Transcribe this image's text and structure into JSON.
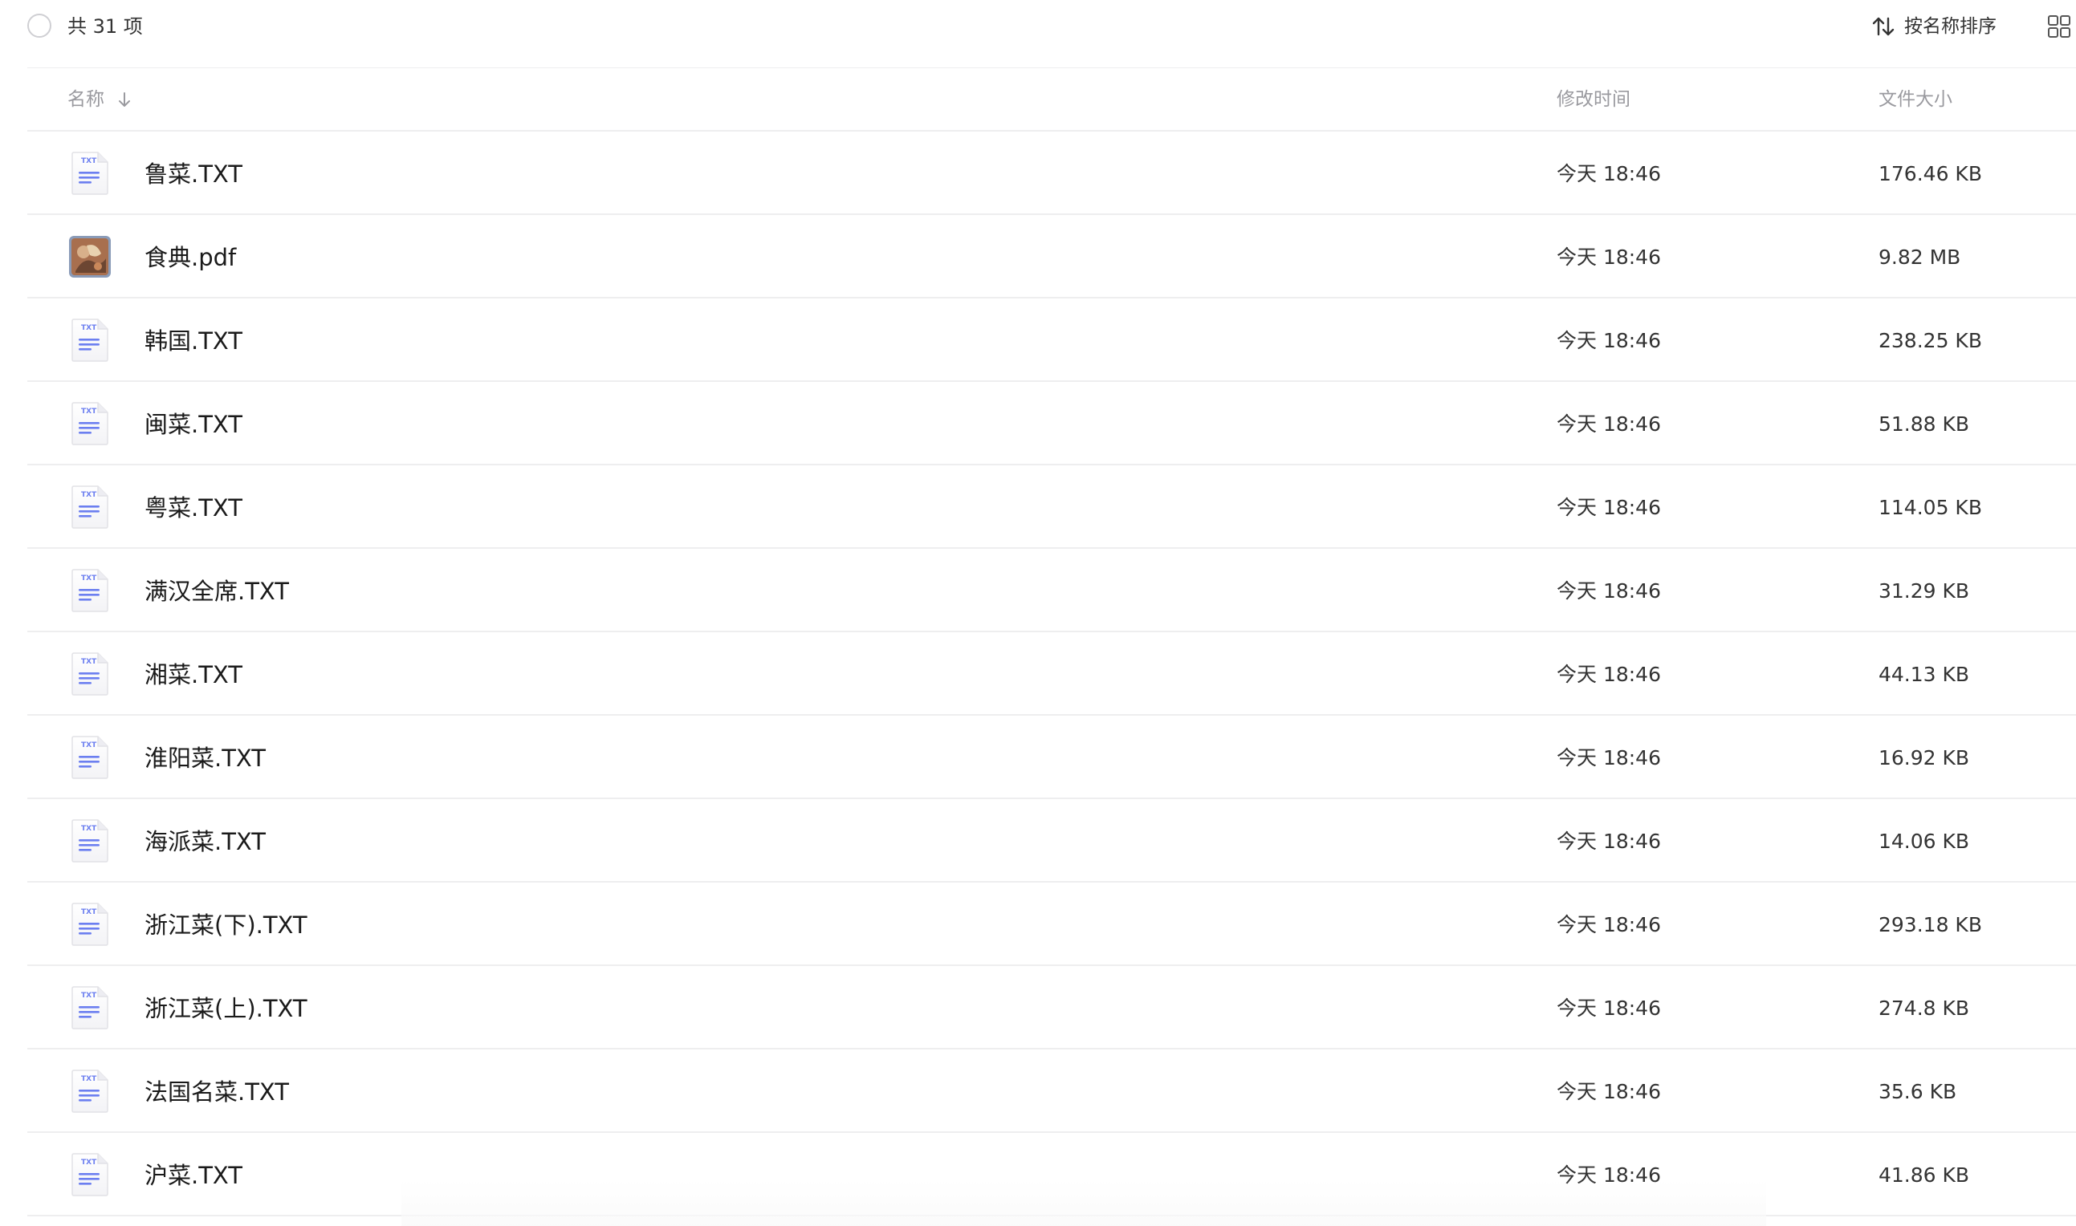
{
  "toolbar": {
    "item_count": "共 31 项",
    "sort_label": "按名称排序",
    "sort_icon": "sort-arrows-icon",
    "view_icon": "grid-view-icon"
  },
  "columns": {
    "name": "名称",
    "modified": "修改时间",
    "size": "文件大小"
  },
  "colors": {
    "txt_icon_accent": "#6c7ff0",
    "divider": "#eeeeef",
    "header_text": "#9a9a9f"
  },
  "files": [
    {
      "name": "鲁菜.TXT",
      "type": "txt",
      "modified": "今天 18:46",
      "size": "176.46 KB"
    },
    {
      "name": "食典.pdf",
      "type": "pdf",
      "modified": "今天 18:46",
      "size": "9.82 MB"
    },
    {
      "name": "韩国.TXT",
      "type": "txt",
      "modified": "今天 18:46",
      "size": "238.25 KB"
    },
    {
      "name": "闽菜.TXT",
      "type": "txt",
      "modified": "今天 18:46",
      "size": "51.88 KB"
    },
    {
      "name": "粤菜.TXT",
      "type": "txt",
      "modified": "今天 18:46",
      "size": "114.05 KB"
    },
    {
      "name": "满汉全席.TXT",
      "type": "txt",
      "modified": "今天 18:46",
      "size": "31.29 KB"
    },
    {
      "name": "湘菜.TXT",
      "type": "txt",
      "modified": "今天 18:46",
      "size": "44.13 KB"
    },
    {
      "name": "淮阳菜.TXT",
      "type": "txt",
      "modified": "今天 18:46",
      "size": "16.92 KB"
    },
    {
      "name": "海派菜.TXT",
      "type": "txt",
      "modified": "今天 18:46",
      "size": "14.06 KB"
    },
    {
      "name": "浙江菜(下).TXT",
      "type": "txt",
      "modified": "今天 18:46",
      "size": "293.18 KB"
    },
    {
      "name": "浙江菜(上).TXT",
      "type": "txt",
      "modified": "今天 18:46",
      "size": "274.8 KB"
    },
    {
      "name": "法国名菜.TXT",
      "type": "txt",
      "modified": "今天 18:46",
      "size": "35.6 KB"
    },
    {
      "name": "沪菜.TXT",
      "type": "txt",
      "modified": "今天 18:46",
      "size": "41.86 KB"
    }
  ]
}
